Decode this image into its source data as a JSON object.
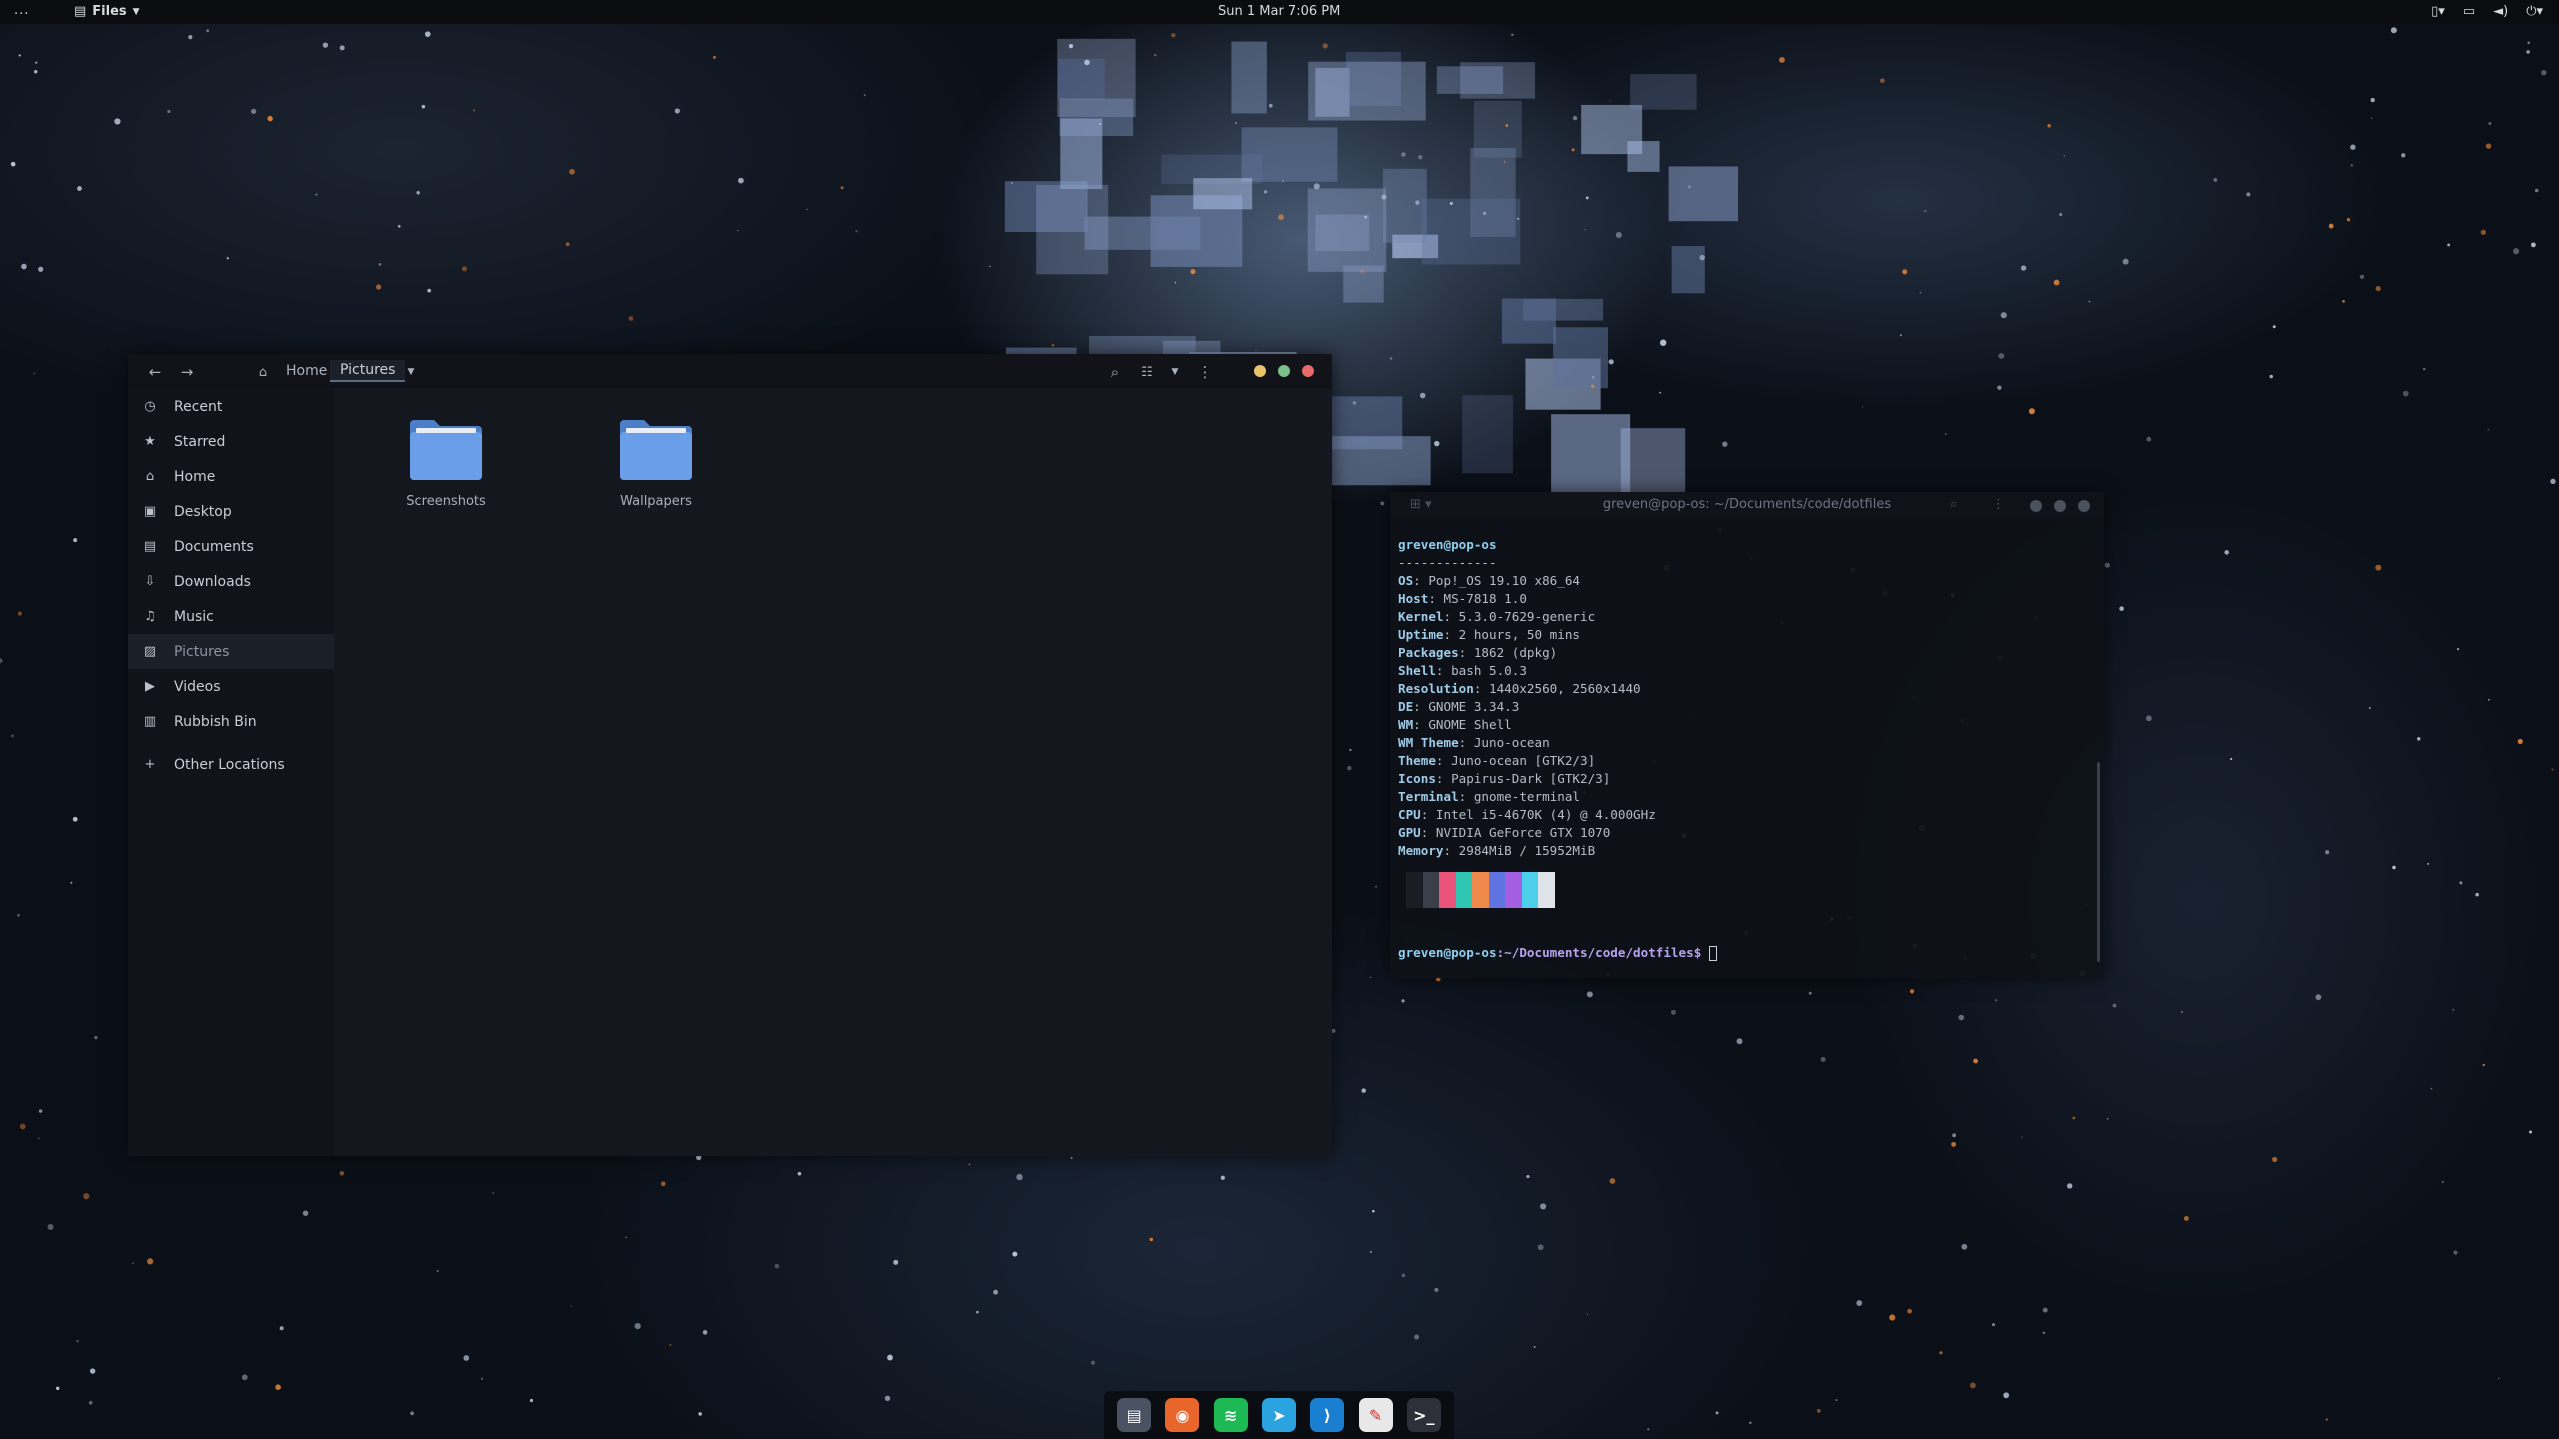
{
  "topbar": {
    "activities": "...",
    "app_name": "Files",
    "clock": "Sun 1 Mar   7:06 PM"
  },
  "files": {
    "breadcrumb_home": "Home",
    "breadcrumb_current": "Pictures",
    "sidebar": [
      {
        "label": "Recent",
        "icon": "clock-icon"
      },
      {
        "label": "Starred",
        "icon": "star-icon"
      },
      {
        "label": "Home",
        "icon": "home-icon"
      },
      {
        "label": "Desktop",
        "icon": "desktop-icon"
      },
      {
        "label": "Documents",
        "icon": "document-icon"
      },
      {
        "label": "Downloads",
        "icon": "download-icon"
      },
      {
        "label": "Music",
        "icon": "music-icon"
      },
      {
        "label": "Pictures",
        "icon": "picture-icon"
      },
      {
        "label": "Videos",
        "icon": "video-icon"
      },
      {
        "label": "Rubbish Bin",
        "icon": "trash-icon"
      },
      {
        "label": "Other Locations",
        "icon": "plus-icon"
      }
    ],
    "folders": [
      "Screenshots",
      "Wallpapers"
    ],
    "folder_color": "#5a8fdc",
    "window_dots": [
      "#e9c46a",
      "#7cc08a",
      "#e56b6b"
    ]
  },
  "terminal": {
    "title": "greven@pop-os: ~/Documents/code/dotfiles",
    "user_host": "greven@pop-os",
    "separator": "-------------",
    "info": [
      {
        "key": "OS",
        "value": "Pop!_OS 19.10 x86_64"
      },
      {
        "key": "Host",
        "value": "MS-7818 1.0"
      },
      {
        "key": "Kernel",
        "value": "5.3.0-7629-generic"
      },
      {
        "key": "Uptime",
        "value": "2 hours, 50 mins"
      },
      {
        "key": "Packages",
        "value": "1862 (dpkg)"
      },
      {
        "key": "Shell",
        "value": "bash 5.0.3"
      },
      {
        "key": "Resolution",
        "value": "1440x2560, 2560x1440"
      },
      {
        "key": "DE",
        "value": "GNOME 3.34.3"
      },
      {
        "key": "WM",
        "value": "GNOME Shell"
      },
      {
        "key": "WM Theme",
        "value": "Juno-ocean"
      },
      {
        "key": "Theme",
        "value": "Juno-ocean [GTK2/3]"
      },
      {
        "key": "Icons",
        "value": "Papirus-Dark [GTK2/3]"
      },
      {
        "key": "Terminal",
        "value": "gnome-terminal"
      },
      {
        "key": "CPU",
        "value": "Intel i5-4670K (4) @ 4.000GHz"
      },
      {
        "key": "GPU",
        "value": "NVIDIA GeForce GTX 1070"
      },
      {
        "key": "Memory",
        "value": "2984MiB / 15952MiB"
      }
    ],
    "swatches": [
      "#1a1d24",
      "#3a3f4a",
      "#e9537a",
      "#2fc7b2",
      "#ef8a4c",
      "#5f74e0",
      "#a45fe0",
      "#4ccfe8",
      "#dfe3ea"
    ],
    "prompt_user": "greven@pop-os",
    "prompt_path": ":~/Documents/code/dotfiles$"
  },
  "dock": [
    {
      "name": "files-icon",
      "color": "#4a5262",
      "glyph": "▤"
    },
    {
      "name": "firefox-icon",
      "color": "#e8652b",
      "glyph": "◉"
    },
    {
      "name": "spotify-icon",
      "color": "#1db954",
      "glyph": "≋"
    },
    {
      "name": "telegram-icon",
      "color": "#2aa3e0",
      "glyph": "➤"
    },
    {
      "name": "vscode-icon",
      "color": "#1b7fd1",
      "glyph": "⟩"
    },
    {
      "name": "text-editor-icon",
      "color": "#e8e8e8",
      "glyph": "✎"
    },
    {
      "name": "terminal-icon",
      "color": "#2d3038",
      "glyph": ">_"
    }
  ]
}
